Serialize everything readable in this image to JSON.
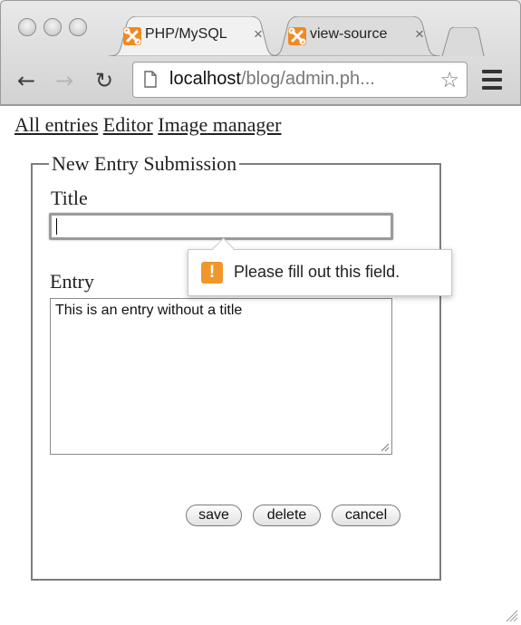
{
  "browser": {
    "tabs": [
      {
        "title": "PHP/MySQL",
        "favicon": "xampp-icon",
        "active": true
      },
      {
        "title": "view-source",
        "favicon": "xampp-icon",
        "active": false
      }
    ],
    "close_glyph": "×",
    "address": {
      "host": "localhost",
      "path": "/blog/admin.ph..."
    },
    "icons": {
      "back": "←",
      "forward": "→",
      "reload": "↻",
      "star": "☆",
      "page": "page-icon",
      "menu": "hamburger-menu-icon"
    },
    "accent_color": "#f08a24"
  },
  "nav": {
    "links": [
      "All entries",
      "Editor",
      "Image manager"
    ]
  },
  "form": {
    "legend": "New Entry Submission",
    "title_label": "Title",
    "title_value": "",
    "entry_label": "Entry",
    "entry_value": "This is an entry without a title",
    "buttons": {
      "save": "save",
      "delete": "delete",
      "cancel": "cancel"
    }
  },
  "validation": {
    "icon_glyph": "!",
    "message": "Please fill out this field.",
    "icon_color": "#f0962a"
  }
}
